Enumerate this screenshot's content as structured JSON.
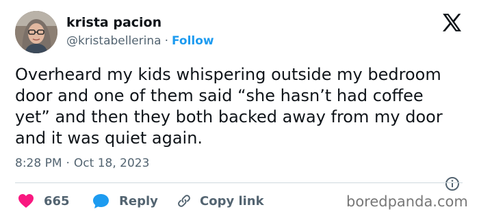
{
  "author": {
    "name": "krista pacion",
    "handle": "@kristabellerina",
    "separator": "·",
    "follow_label": "Follow"
  },
  "tweet": {
    "text": "Overheard my kids whispering outside my bedroom door and one of them said “she hasn’t had coffee yet” and then they both backed away from my door and it was quiet again.",
    "time": "8:28 PM",
    "separator": "·",
    "date": "Oct 18, 2023"
  },
  "actions": {
    "like_count": "665",
    "reply_label": "Reply",
    "copy_label": "Copy link"
  },
  "watermark": "boredpanda.com",
  "icons": {
    "platform": "x-logo-icon",
    "info": "info-icon",
    "like": "heart-icon",
    "reply": "speech-bubble-icon",
    "copy": "link-icon"
  },
  "colors": {
    "accent": "#1d9bf0",
    "like": "#f91880",
    "secondary_text": "#536471",
    "text": "#0f1419"
  }
}
